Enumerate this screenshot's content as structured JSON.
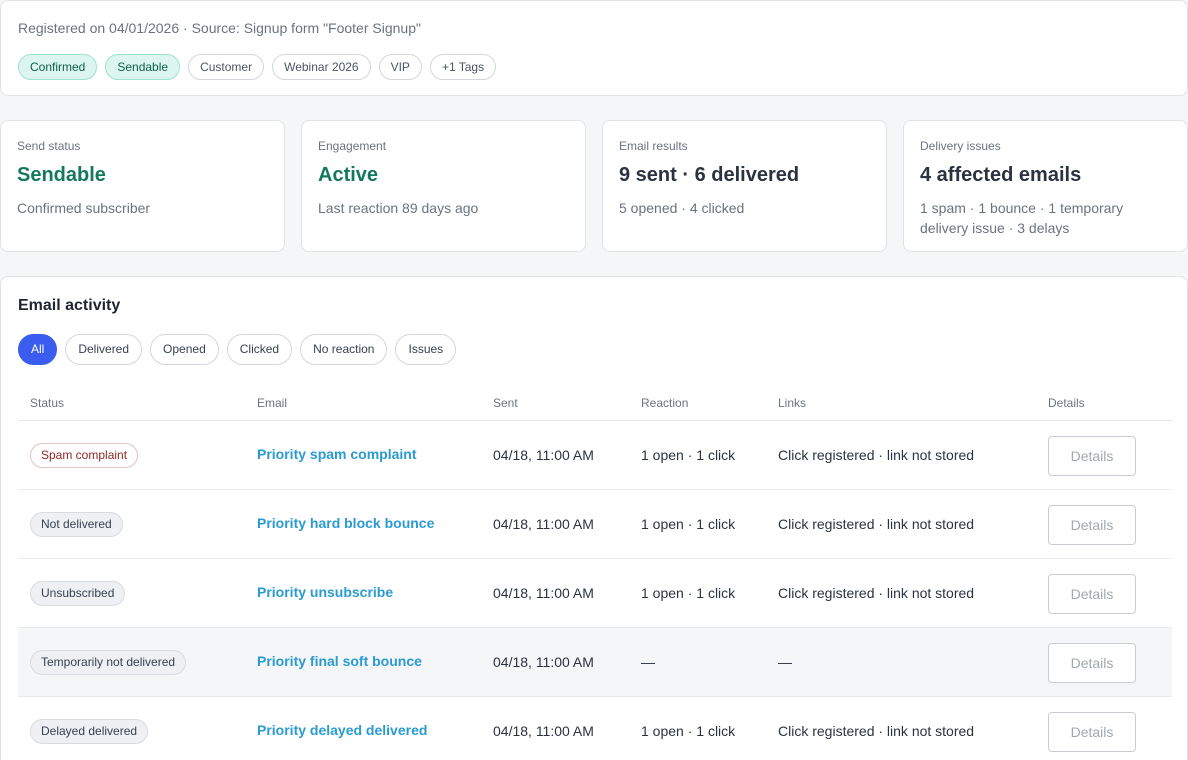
{
  "header": {
    "registered_line": "Registered on 04/01/2026 · Source: Signup form \"Footer Signup\"",
    "tags": [
      {
        "label": "Confirmed",
        "variant": "green"
      },
      {
        "label": "Sendable",
        "variant": "green"
      },
      {
        "label": "Customer",
        "variant": "plain"
      },
      {
        "label": "Webinar 2026",
        "variant": "plain"
      },
      {
        "label": "VIP",
        "variant": "plain"
      },
      {
        "label": "+1 Tags",
        "variant": "plain"
      }
    ]
  },
  "stats": [
    {
      "label": "Send status",
      "value": "Sendable",
      "sub": "Confirmed subscriber",
      "color": "#14795c"
    },
    {
      "label": "Engagement",
      "value": "Active",
      "sub": "Last reaction 89 days ago",
      "color": "#14795c"
    },
    {
      "label": "Email results",
      "value": "9 sent · 6 delivered",
      "sub": "5 opened · 4 clicked",
      "color": "#2b3240"
    },
    {
      "label": "Delivery issues",
      "value": "4 affected emails",
      "sub": "1 spam · 1 bounce · 1 temporary delivery issue · 3 delays",
      "color": "#2b3240"
    }
  ],
  "activity": {
    "title": "Email activity",
    "filters": [
      {
        "label": "All",
        "active": true
      },
      {
        "label": "Delivered",
        "active": false
      },
      {
        "label": "Opened",
        "active": false
      },
      {
        "label": "Clicked",
        "active": false
      },
      {
        "label": "No reaction",
        "active": false
      },
      {
        "label": "Issues",
        "active": false
      }
    ],
    "columns": {
      "status": "Status",
      "email": "Email",
      "sent": "Sent",
      "reaction": "Reaction",
      "links": "Links",
      "details": "Details"
    },
    "rows": [
      {
        "status": "Spam complaint",
        "status_variant": "red",
        "email": "Priority spam complaint",
        "sent": "04/18, 11:00 AM",
        "reaction": "1 open · 1 click",
        "links": "Click registered · link not stored",
        "details": "Details"
      },
      {
        "status": "Not delivered",
        "status_variant": "grey",
        "email": "Priority hard block bounce",
        "sent": "04/18, 11:00 AM",
        "reaction": "1 open · 1 click",
        "links": "Click registered · link not stored",
        "details": "Details"
      },
      {
        "status": "Unsubscribed",
        "status_variant": "grey",
        "email": "Priority unsubscribe",
        "sent": "04/18, 11:00 AM",
        "reaction": "1 open · 1 click",
        "links": "Click registered · link not stored",
        "details": "Details"
      },
      {
        "status": "Temporarily not delivered",
        "status_variant": "grey",
        "email": "Priority final soft bounce",
        "sent": "04/18, 11:00 AM",
        "reaction": "—",
        "links": "—",
        "details": "Details"
      },
      {
        "status": "Delayed delivered",
        "status_variant": "grey",
        "email": "Priority delayed delivered",
        "sent": "04/18, 11:00 AM",
        "reaction": "1 open · 1 click",
        "links": "Click registered · link not stored",
        "details": "Details"
      }
    ]
  },
  "colors": {
    "accent": "#3a5df0",
    "link": "#2a9bd1",
    "positive": "#14795c",
    "danger": "#8e2626"
  }
}
